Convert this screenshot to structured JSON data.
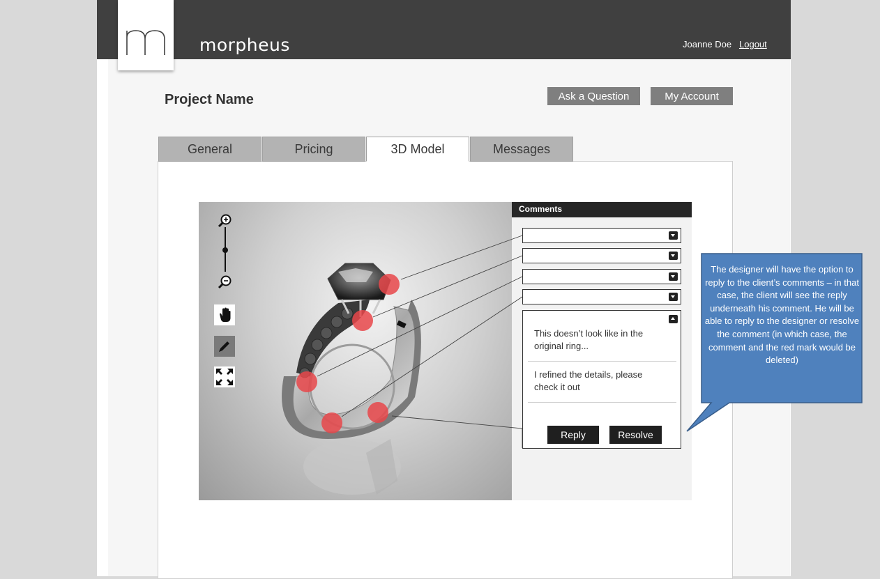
{
  "header": {
    "brand": "morpheus",
    "user_name": "Joanne Doe",
    "logout_label": "Logout"
  },
  "project": {
    "title": "Project Name",
    "ask_button": "Ask a Question",
    "account_button": "My Account"
  },
  "tabs": [
    {
      "label": "General",
      "active": false
    },
    {
      "label": "Pricing",
      "active": false
    },
    {
      "label": "3D Model",
      "active": true
    },
    {
      "label": "Messages",
      "active": false
    }
  ],
  "viewer": {
    "tools": [
      "zoom-in-icon",
      "zoom-slider",
      "zoom-out-icon",
      "hand-icon",
      "pencil-icon",
      "fullscreen-icon"
    ],
    "marker_color": "#e8474a",
    "marker_count": 5
  },
  "comments": {
    "header": "Comments",
    "thread": {
      "comment": "This doesn’t look like in the original ring...",
      "reply": "I refined the details, please check it out"
    },
    "reply_button": "Reply",
    "resolve_button": "Resolve"
  },
  "callout": {
    "text": "The designer will have the option to reply to the client’s comments – in that case, the client will see the reply underneath his comment. He will be able to reply to the designer or resolve the comment (in which case, the comment and the red mark would be deleted)",
    "color": "#4f81bd"
  }
}
